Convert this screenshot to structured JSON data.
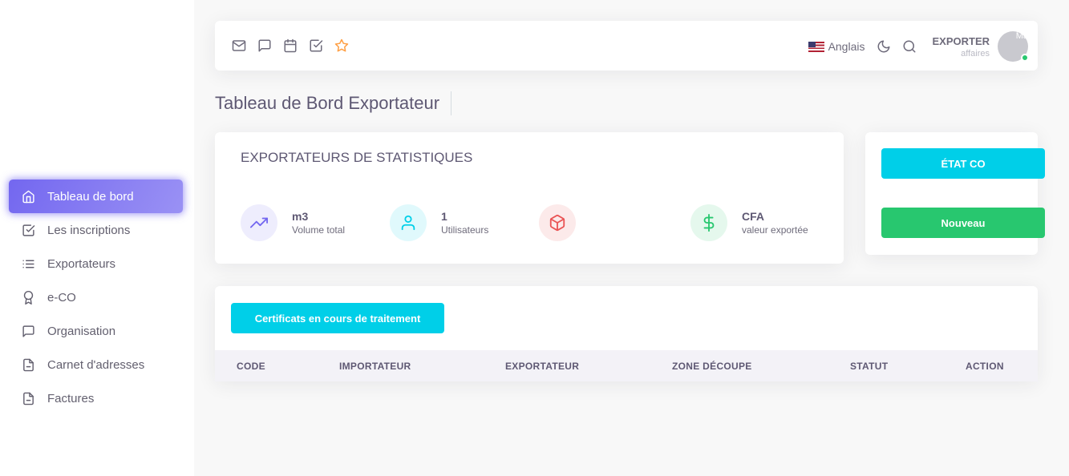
{
  "sidebar": {
    "items": [
      {
        "label": "Tableau de bord",
        "icon": "home-icon"
      },
      {
        "label": "Les inscriptions",
        "icon": "check-square-icon"
      },
      {
        "label": "Exportateurs",
        "icon": "list-icon"
      },
      {
        "label": "e-CO",
        "icon": "award-icon"
      },
      {
        "label": "Organisation",
        "icon": "message-square-icon"
      },
      {
        "label": "Carnet d'adresses",
        "icon": "file-text-icon"
      },
      {
        "label": "Factures",
        "icon": "file-text-icon"
      }
    ]
  },
  "navbar": {
    "icons": [
      "mail-icon",
      "message-square-icon",
      "calendar-icon",
      "check-square-icon",
      "star-icon"
    ],
    "language": "Anglais",
    "user_name": "EXPORTER",
    "user_role": "affaires",
    "avatar_alt": "Ma"
  },
  "page": {
    "title": "Tableau de Bord Exportateur"
  },
  "stats": {
    "title": "EXPORTATEURS DE STATISTIQUES",
    "items": [
      {
        "value": "m3",
        "label": "Volume total",
        "icon": "trending-up-icon",
        "color": "#7367f0"
      },
      {
        "value": "1",
        "label": "Utilisateurs",
        "icon": "user-icon",
        "color": "#00cfe8"
      },
      {
        "value": "",
        "label": "",
        "icon": "box-icon",
        "color": "#ea5455"
      },
      {
        "value": "CFA",
        "label": "valeur exportée",
        "icon": "dollar-sign-icon",
        "color": "#28c76f"
      }
    ]
  },
  "actions": {
    "etat_label": "ÉTAT CO",
    "nouveau_label": "Nouveau"
  },
  "table": {
    "button_label": "Certificats en cours de traitement",
    "columns": [
      "CODE",
      "IMPORTATEUR",
      "EXPORTATEUR",
      "ZONE DÉCOUPE",
      "STATUT",
      "ACTION"
    ]
  },
  "colors": {
    "primary": "#7367f0",
    "info": "#00cfe8",
    "success": "#28c76f",
    "danger": "#ea5455",
    "warning": "#ff9f43"
  }
}
